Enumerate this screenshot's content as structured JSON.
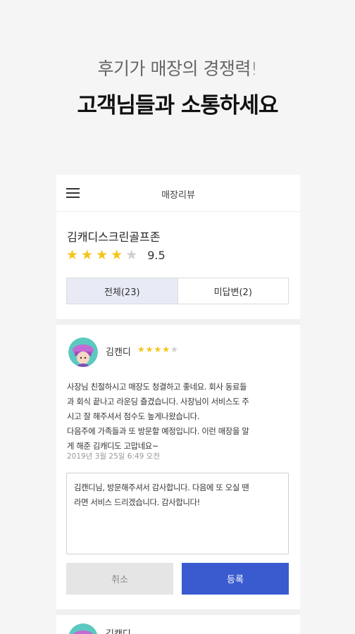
{
  "hero": {
    "subtitle": "후기가 매장의 경쟁력!",
    "title": "고객님들과 소통하세요"
  },
  "appbar": {
    "menu_icon": "hamburger-menu-icon",
    "title": "매장리뷰"
  },
  "store": {
    "name": "김캐디스크린골프존",
    "stars_filled": 4,
    "stars_total": 5,
    "rating": "9.5"
  },
  "tabs": [
    {
      "label": "전체(23)",
      "active": true
    },
    {
      "label": "미답변(2)",
      "active": false
    }
  ],
  "review": {
    "avatar_icon": "avatar-icon",
    "reviewer": "김캔디",
    "stars_filled": 4,
    "stars_total": 5,
    "text": "사장님 친절하시고 매장도 청결하고 좋네요. 회사 동료들\n과 회식 끝나고 라운딩 즐겼습니다. 사장님이 서비스도 주\n시고 잘 해주셔서 점수도 높게나왔습니다.\n다음주에 가족들과 또 방문할 예정입니다. 이런 매장을 알\n게 해준 김캐디도 고맙네요~",
    "date": "2019년 3월 25일 6:49 오전",
    "reply": "김캔디님, 방문해주셔서 감사합니다. 다음에 또 오실 땐\n라면 서비스 드리겠습니다. 감사합니다!",
    "cancel_label": "취소",
    "submit_label": "등록"
  },
  "next_review": {
    "reviewer": "김캔디"
  },
  "colors": {
    "star": "#f5c518",
    "star_off": "#cfcfcf",
    "primary": "#3a5bd0",
    "tab_active_bg": "#e8ebf6"
  }
}
